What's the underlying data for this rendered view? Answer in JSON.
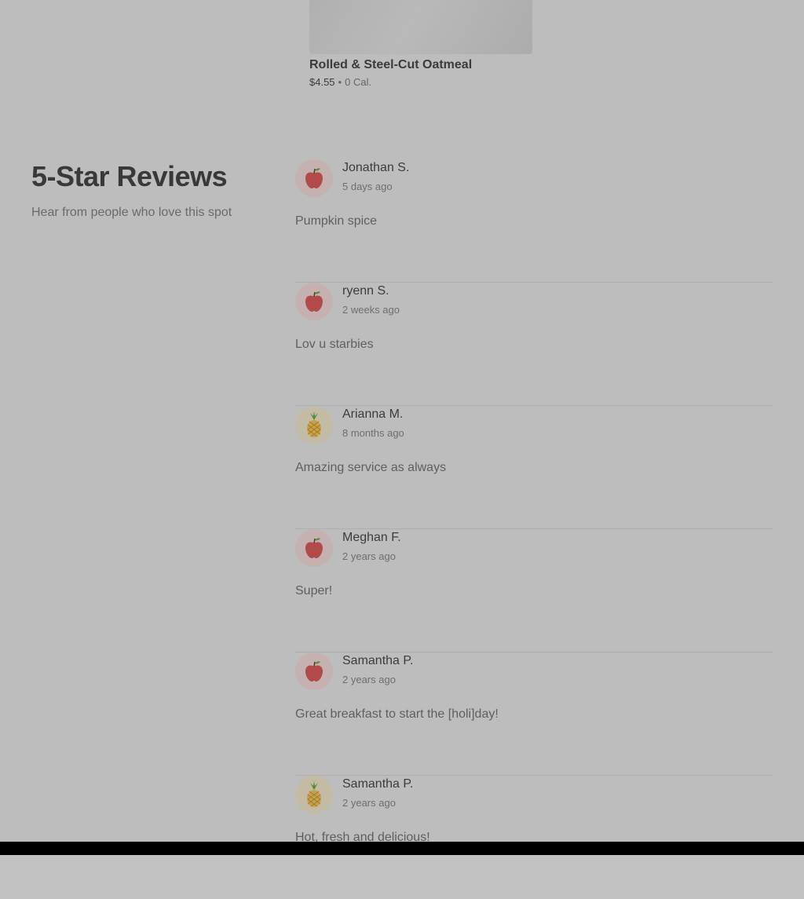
{
  "product": {
    "name": "Rolled & Steel-Cut Oatmeal",
    "price": "$4.55",
    "separator": "•",
    "calories": "0 Cal."
  },
  "reviews_section": {
    "title": "5-Star Reviews",
    "subtitle": "Hear from people who love this spot"
  },
  "reviews": [
    {
      "name": "Jonathan S.",
      "date": "5 days ago",
      "text": "Pumpkin spice",
      "avatar_icon": "apple-icon"
    },
    {
      "name": "ryenn S.",
      "date": "2 weeks ago",
      "text": "Lov u starbies",
      "avatar_icon": "apple-icon"
    },
    {
      "name": "Arianna M.",
      "date": "8 months ago",
      "text": "Amazing service as always",
      "avatar_icon": "pineapple-icon"
    },
    {
      "name": "Meghan F.",
      "date": "2 years ago",
      "text": "Super!",
      "avatar_icon": "apple-icon"
    },
    {
      "name": "Samantha P.",
      "date": "2 years ago",
      "text": "Great breakfast to start the [holi]day!",
      "avatar_icon": "apple-icon"
    },
    {
      "name": "Samantha P.",
      "date": "2 years ago",
      "text": "Hot, fresh and delicious!",
      "avatar_icon": "pineapple-icon"
    }
  ],
  "colors": {
    "background": "#bdbdbd",
    "title_text": "#393939",
    "body_text": "#5f5f5f",
    "divider": "#aeaeae",
    "apple": "#b24a4a",
    "pineapple": "#c9a24a"
  }
}
